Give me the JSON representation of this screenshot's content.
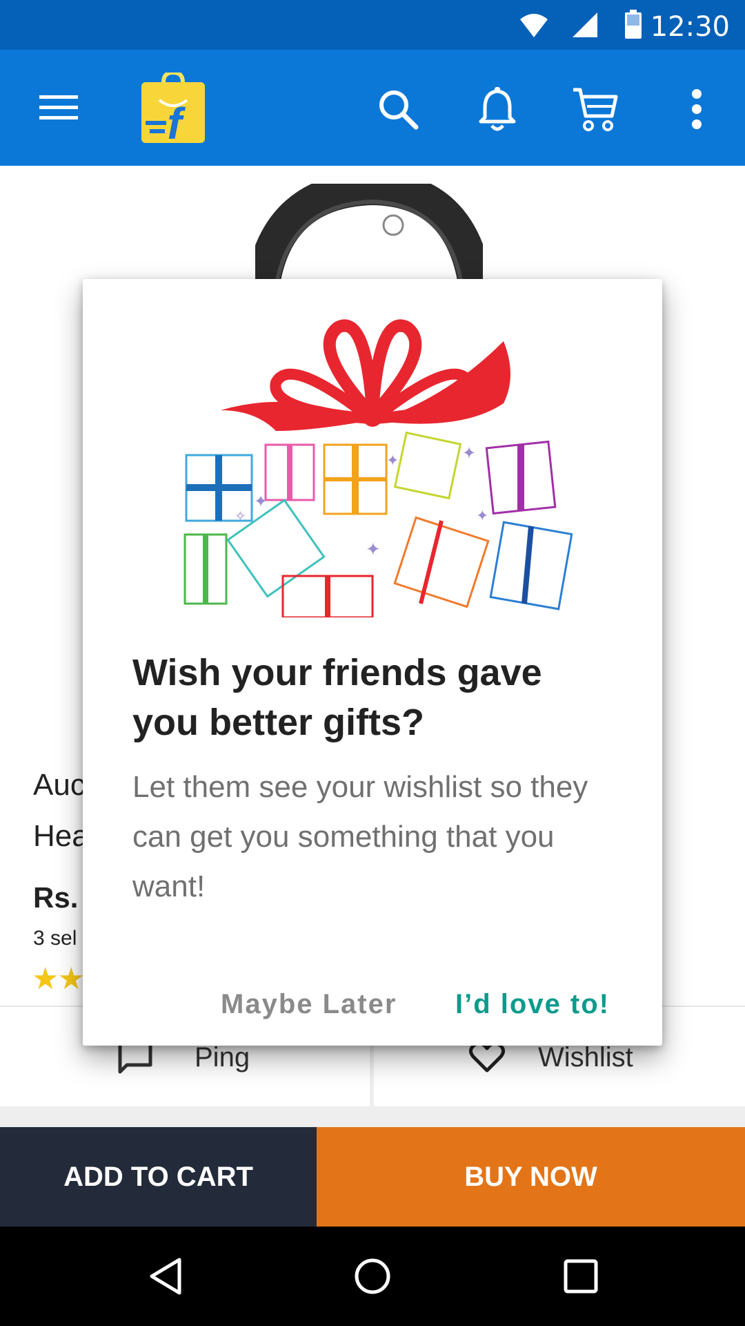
{
  "status_bar": {
    "time": "12:30"
  },
  "app_bar": {
    "brand_color": "#0b78d7",
    "icons": [
      "menu-icon",
      "flipkart-logo",
      "search-icon",
      "bell-icon",
      "cart-icon",
      "more-vert-icon"
    ]
  },
  "product": {
    "title_line1": "Auc",
    "title_line2": "Hea",
    "price": "Rs.",
    "sellers": "3 sel",
    "stars": "★★"
  },
  "actions": {
    "ping_label": "Ping",
    "wishlist_label": "Wishlist"
  },
  "bottom_buttons": {
    "add_to_cart": "ADD TO CART",
    "buy_now": "BUY NOW",
    "add_to_cart_color": "#232b3a",
    "buy_now_color": "#e37518"
  },
  "dialog": {
    "title": "Wish your friends gave you better gifts?",
    "body": "Let them see your wishlist so they can get you something that you want!",
    "dismiss_label": "Maybe Later",
    "confirm_label": "I’d love to!",
    "confirm_color": "#0b9b8c",
    "image": "gift-boxes-illustration"
  }
}
